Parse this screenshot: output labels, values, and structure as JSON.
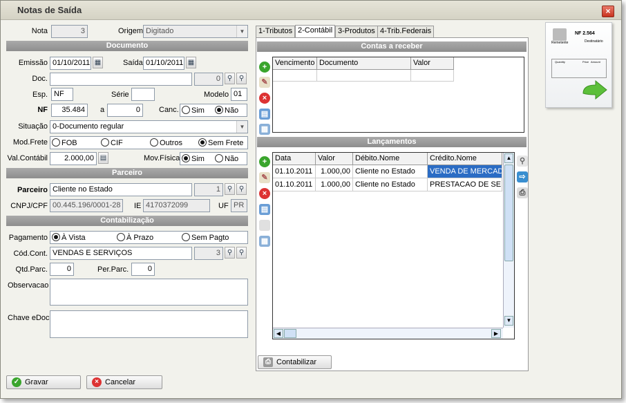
{
  "window": {
    "title": "Notas de Saída",
    "close": "×"
  },
  "left": {
    "nota_label": "Nota",
    "nota_value": "3",
    "origem_label": "Origem",
    "origem_value": "Digitado",
    "sec_documento": "Documento",
    "emissao_label": "Emissão",
    "emissao_value": "01/10/2011",
    "saida_label": "Saída",
    "saida_value": "01/10/2011",
    "doc_label": "Doc.",
    "doc_value": "",
    "doc_num": "0",
    "esp_label": "Esp.",
    "esp_value": "NF",
    "serie_label": "Série",
    "serie_value": "",
    "modelo_label": "Modelo",
    "modelo_value": "01",
    "nf_label": "NF",
    "nf_value": "35.484",
    "a_label": "a",
    "a_value": "0",
    "canc_label": "Canc.",
    "canc_sim": "Sim",
    "canc_nao": "Não",
    "situacao_label": "Situação",
    "situacao_value": "0-Documento regular",
    "modfrete_label": "Mod.Frete",
    "frete_fob": "FOB",
    "frete_cif": "CIF",
    "frete_outros": "Outros",
    "frete_sem": "Sem Frete",
    "valcontabil_label": "Val.Contábil",
    "valcontabil_value": "2.000,00",
    "movfisica_label": "Mov.Física",
    "movfisica_sim": "Sim",
    "movfisica_nao": "Não",
    "sec_parceiro": "Parceiro",
    "parceiro_label": "Parceiro",
    "parceiro_value": "Cliente no Estado",
    "parceiro_num": "1",
    "cnpj_label": "CNPJ/CPF",
    "cnpj_value": "00.445.196/0001-28",
    "ie_label": "IE",
    "ie_value": "4170372099",
    "uf_label": "UF",
    "uf_value": "PR",
    "sec_contabilizacao": "Contabilização",
    "pagamento_label": "Pagamento",
    "pag_vista": "À Vista",
    "pag_prazo": "À Prazo",
    "pag_sem": "Sem Pagto",
    "codcont_label": "Cód.Cont.",
    "codcont_value": "VENDAS E SERVIÇOS",
    "codcont_num": "3",
    "qtdparc_label": "Qtd.Parc.",
    "qtdparc_value": "0",
    "perparc_label": "Per.Parc.",
    "perparc_value": "0",
    "obs_label": "Observacao",
    "chave_label": "Chave eDoc"
  },
  "tabs": [
    {
      "label": "1-Tributos"
    },
    {
      "label": "2-Contábil"
    },
    {
      "label": "3-Produtos"
    },
    {
      "label": "4-Trib.Federais"
    }
  ],
  "contas": {
    "title": "Contas a receber",
    "headers": [
      "Vencimento",
      "Documento",
      "Valor"
    ]
  },
  "lancamentos": {
    "title": "Lançamentos",
    "headers": [
      "Data",
      "Valor",
      "Débito.Nome",
      "Crédito.Nome"
    ],
    "rows": [
      [
        "01.10.2011",
        "1.000,00",
        "Cliente no Estado",
        "VENDA DE MERCADOR"
      ],
      [
        "01.10.2011",
        "1.000,00",
        "Cliente no Estado",
        "PRESTACAO DE SERVI"
      ]
    ]
  },
  "contabilizar_label": "Contabilizar",
  "gravar_label": "Gravar",
  "cancelar_label": "Cancelar",
  "nf_image": {
    "badge": "NF 2.564",
    "remetente": "Remetente",
    "destinatario": "Destinatário",
    "col1": "Quantity",
    "col2": "Price",
    "col3": "Amount"
  },
  "colors": {
    "accent": "#2b6cc4",
    "section": "#8d8d8d"
  }
}
